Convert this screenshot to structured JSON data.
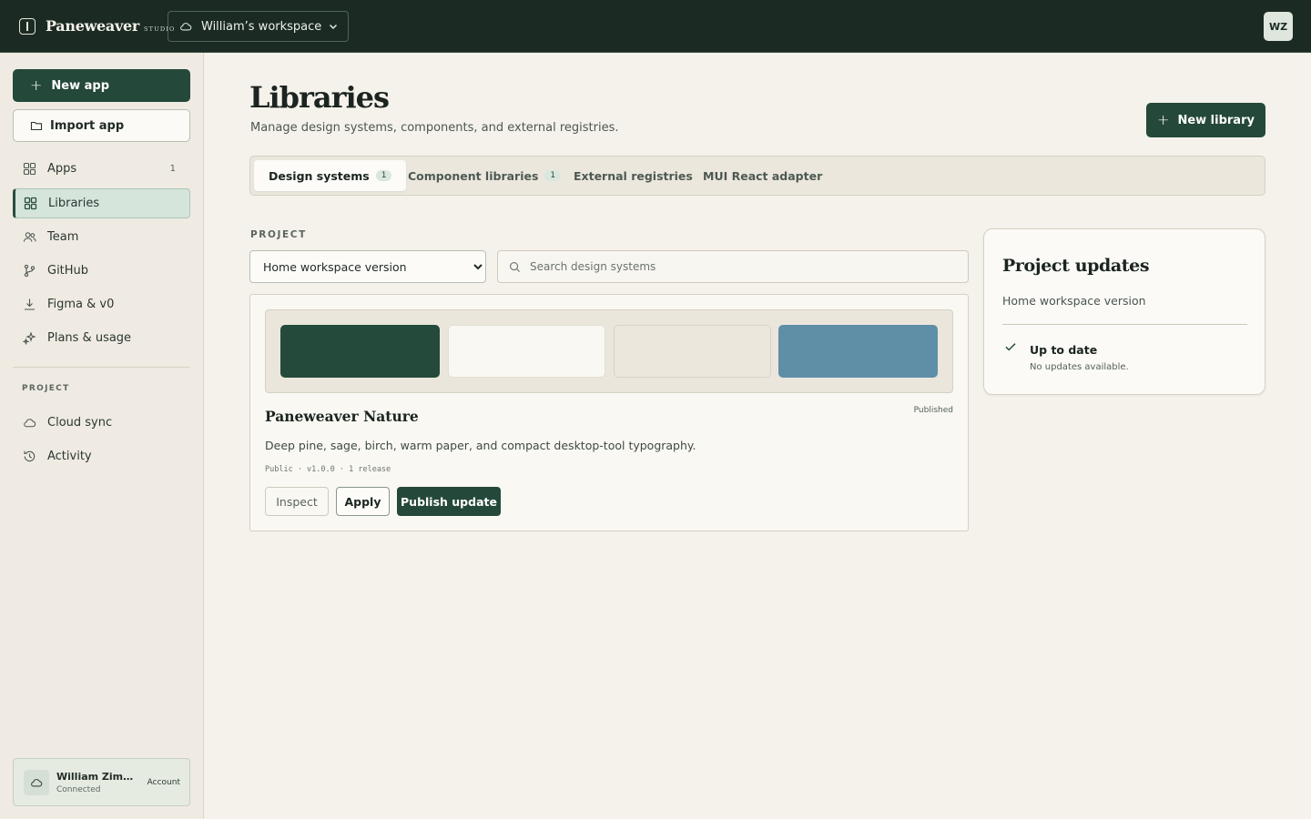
{
  "topbar": {
    "brand": "Paneweaver",
    "brand_suffix": "STUDIO",
    "workspace": "William’s workspace",
    "avatar_initials": "WZ"
  },
  "sidebar": {
    "new_app": "New app",
    "import_app": "Import app",
    "items": [
      {
        "label": "Apps",
        "count": "1"
      },
      {
        "label": "Libraries",
        "count": ""
      },
      {
        "label": "Team",
        "count": ""
      },
      {
        "label": "GitHub",
        "count": ""
      },
      {
        "label": "Figma & v0",
        "count": ""
      },
      {
        "label": "Plans & usage",
        "count": ""
      }
    ],
    "active_item": "Libraries",
    "project_section": "PROJECT",
    "project_items": [
      {
        "label": "Cloud sync"
      },
      {
        "label": "Activity"
      }
    ],
    "account": {
      "name": "William Zimmerman",
      "status": "Connected",
      "link": "Account"
    }
  },
  "main": {
    "title": "Libraries",
    "subtitle": "Manage design systems, components, and external registries.",
    "new_library": "New library",
    "tabs": [
      {
        "label": "Design systems",
        "badge": "1"
      },
      {
        "label": "Component libraries",
        "badge": "1"
      },
      {
        "label": "External registries",
        "badge": ""
      },
      {
        "label": "MUI React adapter",
        "badge": ""
      }
    ],
    "active_tab": "Design systems",
    "project_label": "PROJECT",
    "project_select": {
      "value": "Home workspace version",
      "options": [
        "Home workspace version"
      ]
    },
    "search": {
      "placeholder": "Search design systems",
      "value": ""
    },
    "design_system": {
      "name": "Paneweaver Nature",
      "status": "Published",
      "description": "Deep pine, sage, birch, warm paper, and compact desktop-tool typography.",
      "meta": "Public · v1.0.0 · 1 release",
      "swatches": [
        "#234a3a",
        "#faf8f3",
        "#ece7dd",
        "#5f8ea7"
      ],
      "actions": {
        "inspect": "Inspect",
        "apply": "Apply",
        "publish": "Publish update"
      }
    },
    "updates": {
      "title": "Project updates",
      "project": "Home workspace version",
      "status": "Up to date",
      "detail": "No updates available."
    }
  },
  "colors": {
    "topbar_bg": "#1b2b24",
    "accent": "#24483a",
    "page_bg": "#f5f2eb",
    "sidebar_bg": "#efebe2",
    "active_nav_bg": "#d5e5dc"
  }
}
